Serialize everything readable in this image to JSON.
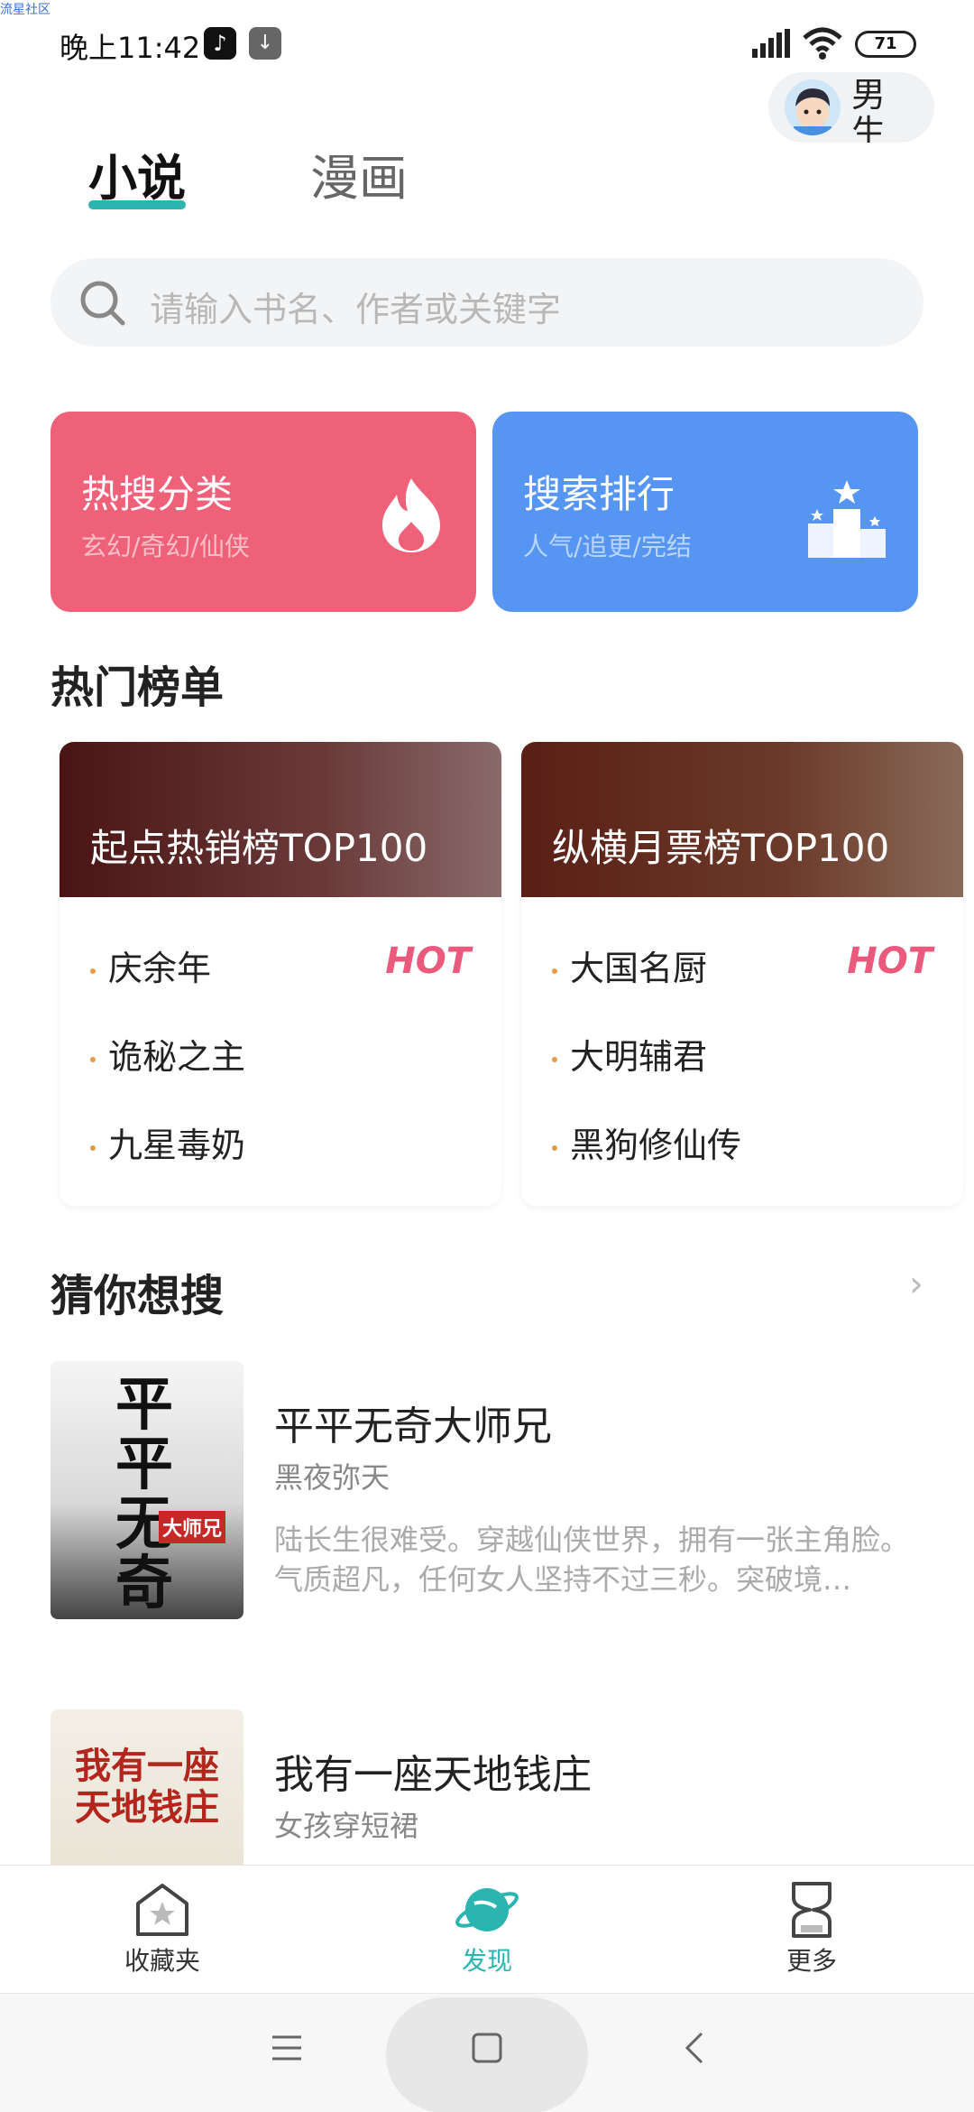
{
  "watermark": "流星社区",
  "status": {
    "time": "晚上11:42",
    "battery": "71"
  },
  "gender": {
    "label": "男生"
  },
  "tabs": [
    {
      "label": "小说"
    },
    {
      "label": "漫画"
    }
  ],
  "search": {
    "placeholder": "请输入书名、作者或关键字"
  },
  "categories": [
    {
      "title": "热搜分类",
      "subtitle": "玄幻/奇幻/仙侠",
      "color": "#ef6079",
      "icon": "flame-icon"
    },
    {
      "title": "搜索排行",
      "subtitle": "人气/追更/完结",
      "color": "#5696f2",
      "icon": "podium-icon"
    }
  ],
  "hot_section": {
    "title": "热门榜单"
  },
  "boards": [
    {
      "title": "起点热销榜TOP100",
      "badge": "HOT",
      "items": [
        "庆余年",
        "诡秘之主",
        "九星毒奶"
      ]
    },
    {
      "title": "纵横月票榜TOP100",
      "badge": "HOT",
      "items": [
        "大国名厨",
        "大明辅君",
        "黑狗修仙传"
      ]
    }
  ],
  "guess_section": {
    "title": "猜你想搜",
    "more": "›"
  },
  "books": [
    {
      "title": "平平无奇大师兄",
      "author": "黑夜弥天",
      "description": "陆长生很难受。穿越仙侠世界，拥有一张主角脸。气质超凡，任何女人坚持不过三秒。突破境…",
      "cover_text": "平平无奇",
      "cover_badge": "大师兄"
    },
    {
      "title": "我有一座天地钱庄",
      "author": "女孩穿短裙",
      "description": "",
      "cover_text": "我有一座天地钱庄"
    }
  ],
  "bottom_nav": [
    {
      "label": "收藏夹",
      "icon": "bookmark-star-icon"
    },
    {
      "label": "发现",
      "icon": "planet-icon",
      "active": true
    },
    {
      "label": "更多",
      "icon": "hourglass-icon"
    }
  ],
  "accent_color": "#2bb5b0"
}
